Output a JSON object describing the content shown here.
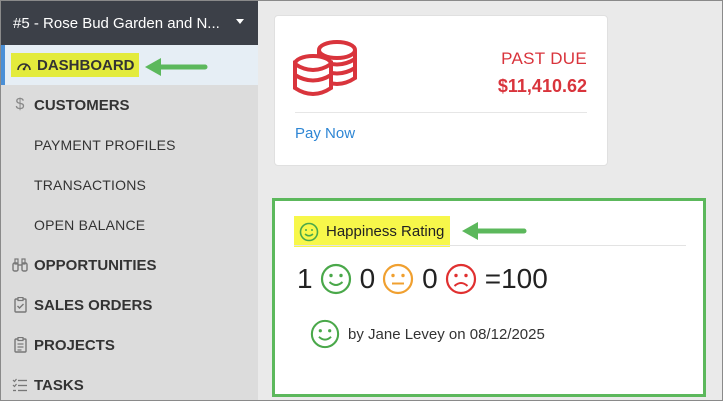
{
  "sidebar": {
    "account_selector": "#5 - Rose Bud Garden and N...",
    "items": [
      {
        "label": "DASHBOARD",
        "icon": "dashboard-icon"
      },
      {
        "label": "CUSTOMERS",
        "icon": "dollar-icon"
      },
      {
        "label": "PAYMENT PROFILES"
      },
      {
        "label": "TRANSACTIONS"
      },
      {
        "label": "OPEN BALANCE"
      },
      {
        "label": "OPPORTUNITIES",
        "icon": "binoculars-icon"
      },
      {
        "label": "SALES ORDERS",
        "icon": "clipboard-check-icon"
      },
      {
        "label": "PROJECTS",
        "icon": "clipboard-list-icon"
      },
      {
        "label": "TASKS",
        "icon": "task-list-icon"
      }
    ]
  },
  "past_due": {
    "label": "PAST DUE",
    "amount": "$11,410.62",
    "action": "Pay Now",
    "icon": "coins-icon"
  },
  "happiness": {
    "title": "Happiness Rating",
    "happy_count": "1",
    "neutral_count": "0",
    "sad_count": "0",
    "score": "=100",
    "attribution": "by Jane Levey on 08/12/2025"
  },
  "colors": {
    "sidebar_bg": "#dcdcdc",
    "header_bg": "#3c4048",
    "past_due_red": "#d9343c",
    "link_blue": "#2e86d4",
    "highlight_yellow": "#f7f74a",
    "accent_green": "#5cb85c",
    "neutral_orange": "#f0a030",
    "sad_red": "#e03030"
  }
}
